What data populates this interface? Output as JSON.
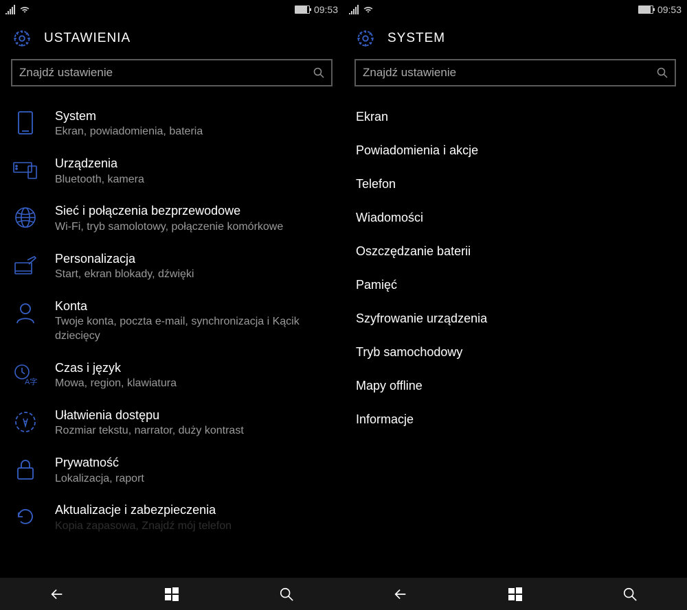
{
  "status": {
    "time": "09:53"
  },
  "left": {
    "title": "USTAWIENIA",
    "search_placeholder": "Znajdź ustawienie",
    "items": [
      {
        "title": "System",
        "subtitle": "Ekran, powiadomienia, bateria"
      },
      {
        "title": "Urządzenia",
        "subtitle": "Bluetooth, kamera"
      },
      {
        "title": "Sieć i połączenia bezprzewodowe",
        "subtitle": "Wi-Fi, tryb samolotowy, połączenie komórkowe"
      },
      {
        "title": "Personalizacja",
        "subtitle": "Start, ekran blokady, dźwięki"
      },
      {
        "title": "Konta",
        "subtitle": "Twoje konta, poczta e-mail, synchronizacja i Kącik dziecięcy"
      },
      {
        "title": "Czas i język",
        "subtitle": "Mowa, region, klawiatura"
      },
      {
        "title": "Ułatwienia dostępu",
        "subtitle": "Rozmiar tekstu, narrator, duży kontrast"
      },
      {
        "title": "Prywatność",
        "subtitle": "Lokalizacja, raport"
      },
      {
        "title": "Aktualizacje i zabezpieczenia",
        "subtitle": "Kopia zapasowa, Znajdź mój telefon"
      }
    ]
  },
  "right": {
    "title": "SYSTEM",
    "search_placeholder": "Znajdź ustawienie",
    "items": [
      "Ekran",
      "Powiadomienia i akcje",
      "Telefon",
      "Wiadomości",
      "Oszczędzanie baterii",
      "Pamięć",
      "Szyfrowanie urządzenia",
      "Tryb samochodowy",
      "Mapy offline",
      "Informacje"
    ]
  },
  "accent": "#3660c7"
}
